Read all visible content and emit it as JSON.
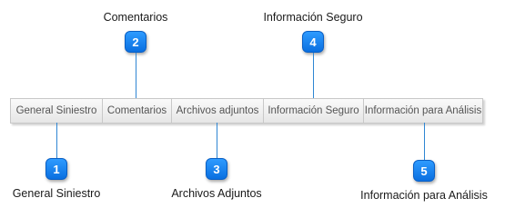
{
  "tabs": [
    {
      "label": "General Siniestro"
    },
    {
      "label": "Comentarios"
    },
    {
      "label": "Archivos adjuntos"
    },
    {
      "label": "Información Seguro"
    },
    {
      "label": "Información para Análisis"
    }
  ],
  "callouts": [
    {
      "number": "1",
      "caption": "General Siniestro"
    },
    {
      "number": "2",
      "caption": "Comentarios"
    },
    {
      "number": "3",
      "caption": "Archivos Adjuntos"
    },
    {
      "number": "4",
      "caption": "Información Seguro"
    },
    {
      "number": "5",
      "caption": "Información para Análisis"
    }
  ],
  "colors": {
    "badge": "#1a86f2",
    "connector": "#2f86d3"
  }
}
